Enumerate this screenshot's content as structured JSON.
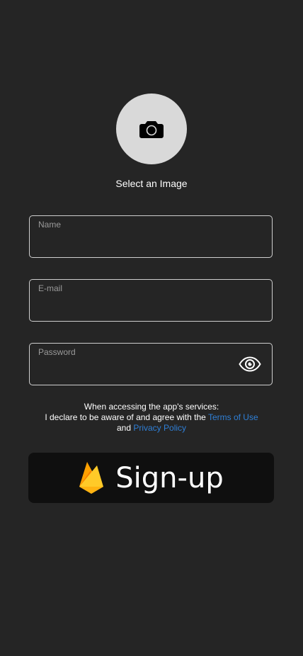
{
  "avatar": {
    "icon": "camera-icon",
    "label": "Select an Image"
  },
  "form": {
    "name_label": "Name",
    "email_label": "E-mail",
    "password_label": "Password",
    "password_toggle_icon": "eye-icon"
  },
  "legal": {
    "line1": "When accessing the app's services:",
    "line2_prefix": "I declare to be aware of and agree with the",
    "terms_link": "Terms of Use",
    "line3_prefix": "and",
    "privacy_link": "Privacy Policy"
  },
  "signup": {
    "icon": "firebase-icon",
    "label": "Sign-up"
  },
  "colors": {
    "background": "#252525",
    "avatar_bg": "#d9d9d9",
    "field_border": "#cfcfcf",
    "link": "#2f7fd6",
    "button_bg": "#0f0f0f"
  }
}
